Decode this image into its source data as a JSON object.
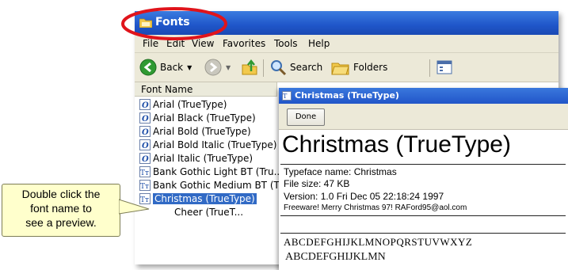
{
  "window": {
    "title": "Fonts",
    "menu": [
      "File",
      "Edit",
      "View",
      "Favorites",
      "Tools",
      "Help"
    ],
    "toolbar": {
      "back_label": "Back",
      "search_label": "Search",
      "folders_label": "Folders"
    },
    "list_header": "Font Name",
    "fonts": [
      "Arial (TrueType)",
      "Arial Black (TrueType)",
      "Arial Bold (TrueType)",
      "Arial Bold Italic (TrueType)",
      "Arial Italic (TrueType)",
      "Bank Gothic Light BT (Tru...",
      "Bank Gothic Medium BT (T...",
      "Christmas (TrueType)",
      "Cheer (TrueT..."
    ],
    "selected_font": "Christmas (TrueType)"
  },
  "preview": {
    "title": "Christmas (TrueType)",
    "done_label": "Done",
    "heading": "Christmas (TrueType)",
    "typeface_line": "Typeface name: Christmas",
    "filesize_line": "File size: 47 KB",
    "version_line": "Version: 1.0 Fri Dec 05 22:18:24 1997",
    "freeware_line": "Freeware! Merry Christmas 97! RAFord95@aol.com",
    "sample_upper": "ABCDEFGHIJKLMNOPQRSTUVWXYZ",
    "sample_deco": "ABCDEFGHIJKLMN"
  },
  "callout": {
    "line1": "Double click the",
    "line2": "font name to",
    "line3": "see a preview."
  },
  "colors": {
    "highlight_ellipse": "#e0141b",
    "titlebar": "#1f56c9",
    "selection": "#316ac5",
    "callout_bg": "#ffffcc"
  }
}
